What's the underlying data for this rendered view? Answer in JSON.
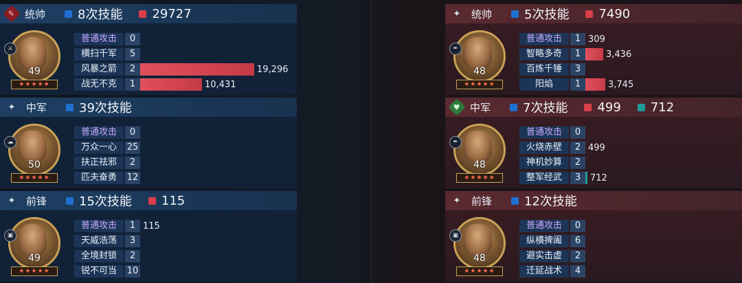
{
  "left": {
    "panels": [
      {
        "role": "统帅",
        "skill_count": "8次技能",
        "damage": "29727",
        "level": "49",
        "skills": [
          {
            "name": "普通攻击",
            "count": "0",
            "value": "",
            "ratio": 0,
            "normal": true
          },
          {
            "name": "横扫千军",
            "count": "5",
            "value": "",
            "ratio": 0
          },
          {
            "name": "风暴之箭",
            "count": "2",
            "value": "19,296",
            "ratio": 1.0
          },
          {
            "name": "战无不克",
            "count": "1",
            "value": "10,431",
            "ratio": 0.54
          }
        ]
      },
      {
        "role": "中军",
        "skill_count": "39次技能",
        "level": "50",
        "skills": [
          {
            "name": "普通攻击",
            "count": "0",
            "value": "",
            "ratio": 0,
            "normal": true
          },
          {
            "name": "万众一心",
            "count": "25",
            "value": "",
            "ratio": 0
          },
          {
            "name": "扶正祛邪",
            "count": "2",
            "value": "",
            "ratio": 0
          },
          {
            "name": "匹夫奋勇",
            "count": "12",
            "value": "",
            "ratio": 0
          }
        ]
      },
      {
        "role": "前锋",
        "skill_count": "15次技能",
        "damage": "115",
        "level": "49",
        "skills": [
          {
            "name": "普通攻击",
            "count": "1",
            "value": "115",
            "ratio": 0,
            "normal": true
          },
          {
            "name": "天威浩荡",
            "count": "3",
            "value": "",
            "ratio": 0
          },
          {
            "name": "全境封锁",
            "count": "2",
            "value": "",
            "ratio": 0
          },
          {
            "name": "锐不可当",
            "count": "10",
            "value": "",
            "ratio": 0
          }
        ]
      }
    ]
  },
  "right": {
    "panels": [
      {
        "role": "统帅",
        "skill_count": "5次技能",
        "damage": "7490",
        "level": "48",
        "skills": [
          {
            "name": "普通攻击",
            "count": "1",
            "value": "309",
            "ratio": 0,
            "normal": true
          },
          {
            "name": "智略多奇",
            "count": "1",
            "value": "3,436",
            "ratio": 0.92
          },
          {
            "name": "百炼千锤",
            "count": "3",
            "value": "",
            "ratio": 0
          },
          {
            "name": "阳焰",
            "count": "1",
            "value": "3,745",
            "ratio": 1.0
          }
        ]
      },
      {
        "role": "中军",
        "skill_count": "7次技能",
        "damage": "499",
        "heal": "712",
        "level": "48",
        "skills": [
          {
            "name": "普通攻击",
            "count": "0",
            "value": "",
            "ratio": 0,
            "normal": true
          },
          {
            "name": "火烧赤壁",
            "count": "2",
            "value": "499",
            "ratio": 0
          },
          {
            "name": "神机妙算",
            "count": "2",
            "value": "",
            "ratio": 0
          },
          {
            "name": "整军经武",
            "count": "3",
            "value": "712",
            "ratio": 0,
            "teal": true
          }
        ]
      },
      {
        "role": "前锋",
        "skill_count": "12次技能",
        "level": "48",
        "skills": [
          {
            "name": "普通攻击",
            "count": "0",
            "value": "",
            "ratio": 0,
            "normal": true
          },
          {
            "name": "纵横捭阖",
            "count": "6",
            "value": "",
            "ratio": 0
          },
          {
            "name": "避实击虚",
            "count": "2",
            "value": "",
            "ratio": 0
          },
          {
            "name": "迁延战术",
            "count": "4",
            "value": "",
            "ratio": 0
          }
        ]
      }
    ]
  },
  "stars_text": "★★★★★"
}
